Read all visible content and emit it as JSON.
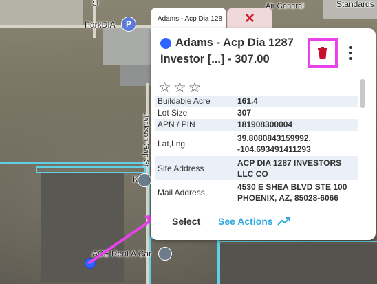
{
  "map": {
    "labels": {
      "parkdia": "ParkDIA",
      "parkdia_pin": "P",
      "air_general": "Air General",
      "standards": "Standards",
      "jackson_gap": "Jackson Gap St",
      "karo": "Karo",
      "ace_rent": "ACE Rent A Car",
      "street_top": "St"
    }
  },
  "popup": {
    "tab_label": "Adams - Acp Dia 128",
    "close_icon": "×",
    "title": "Adams - Acp Dia 1287 Investor [...] - 307.00",
    "title_dot_color": "#2f63ff",
    "rating_stars": "☆☆☆",
    "details": [
      {
        "key": "Buildable Acre",
        "value": "161.4"
      },
      {
        "key": "Lot Size",
        "value": "307"
      },
      {
        "key": "APN / PIN",
        "value": "181908300004"
      },
      {
        "key": "Lat,Lng",
        "value": "39.8080843159992, -104.693491411293"
      },
      {
        "key": "Site Address",
        "value": "ACP DIA 1287 INVESTORS LLC CO"
      },
      {
        "key": "Mail Address",
        "value": "4530 E SHEA BLVD STE 100 PHOENIX, AZ, 85028-6066"
      }
    ],
    "select_label": "Select",
    "actions_label": "See Actions"
  },
  "colors": {
    "highlight": "#e843e8",
    "delete": "#c8102e",
    "accent": "#2ea9e0",
    "parcel": "#5fd0e6"
  }
}
